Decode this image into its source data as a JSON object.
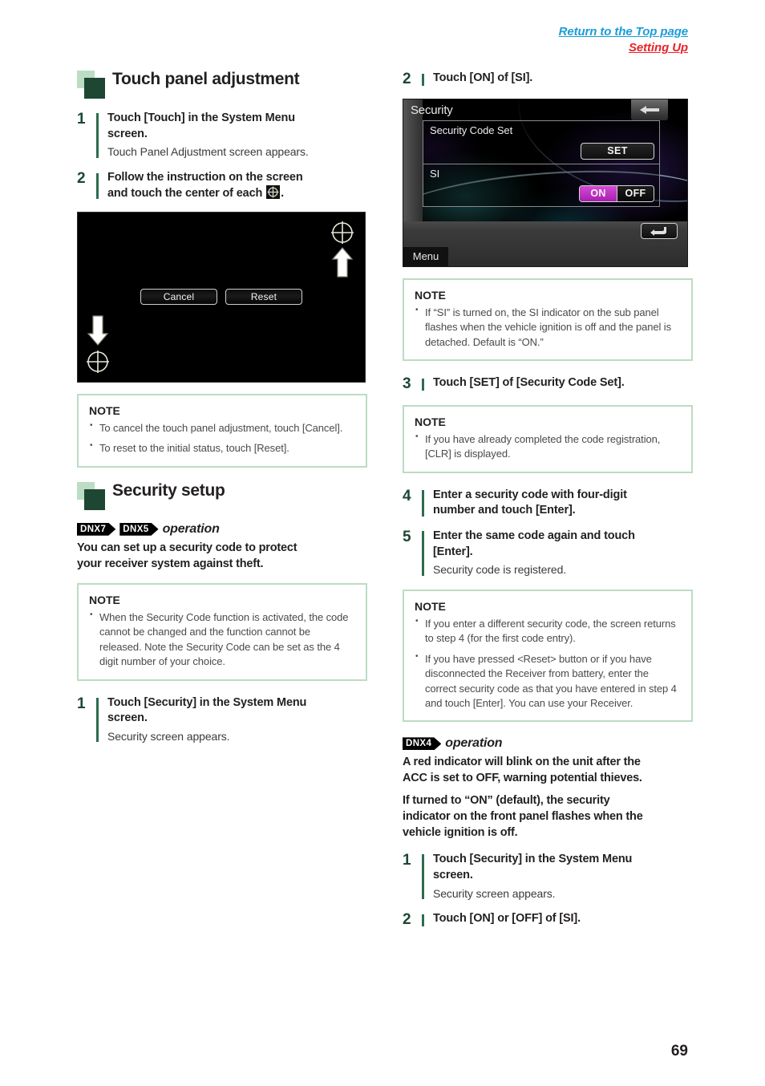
{
  "header": {
    "return_link": "Return to the Top page",
    "section_link": "Setting Up"
  },
  "page_number": "69",
  "left_column": {
    "section_title": "Touch panel adjustment",
    "steps": [
      {
        "num": "1",
        "title_a": "Touch [Touch] in the System Menu",
        "title_b": "screen.",
        "sub": "Touch Panel Adjustment screen appears."
      },
      {
        "num": "2",
        "title_a": "Follow the instruction on the screen",
        "title_b": "and touch the center of each",
        "title_c": "."
      }
    ],
    "touch_panel_screenshot": {
      "cancel_button": "Cancel",
      "reset_button": "Reset"
    },
    "note1": {
      "title": "NOTE",
      "items": [
        "To cancel the touch panel adjustment, touch [Cancel].",
        "To reset to the initial status, touch [Reset]."
      ]
    },
    "security_section_title": "Security setup",
    "operation": {
      "badges": [
        "DNX7",
        "DNX5"
      ],
      "word": "operation",
      "body_a": "You can set up a security code to protect",
      "body_b": "your receiver system against theft."
    },
    "note2": {
      "title": "NOTE",
      "items": [
        "When the Security Code function is activated, the code cannot be changed and the function cannot be released. Note the Security Code can be set as the 4 digit number of your choice."
      ]
    },
    "step_security_1": {
      "num": "1",
      "title_a": "Touch [Security] in the System Menu",
      "title_b": "screen.",
      "sub": "Security screen appears."
    }
  },
  "right_column": {
    "step2": {
      "num": "2",
      "title": "Touch [ON] of [SI]."
    },
    "security_screenshot": {
      "title": "Security",
      "row1_label": "Security Code Set",
      "set_button": "SET",
      "row2_label": "SI",
      "toggle_on": "ON",
      "toggle_off": "OFF",
      "menu_label": "Menu"
    },
    "note1": {
      "title": "NOTE",
      "items": [
        "If “SI” is turned on, the SI indicator on the sub panel flashes when the vehicle ignition is off and the panel is detached. Default is “ON.”"
      ]
    },
    "step3": {
      "num": "3",
      "title": "Touch [SET] of [Security Code Set]."
    },
    "note2": {
      "title": "NOTE",
      "items": [
        "If you have already completed the code registration, [CLR] is displayed."
      ]
    },
    "step4": {
      "num": "4",
      "title_a": "Enter a security code with four-digit",
      "title_b": "number and touch [Enter]."
    },
    "step5": {
      "num": "5",
      "title_a": "Enter the same code again and touch",
      "title_b": "[Enter].",
      "sub": "Security code is registered."
    },
    "note3": {
      "title": "NOTE",
      "items": [
        "If you enter a different security code, the screen returns to step 4 (for the first code entry).",
        "If you have pressed <Reset> button or if you have disconnected the Receiver from battery, enter the correct security code as that you have entered in step 4 and touch [Enter]. You can use your Receiver."
      ]
    },
    "operation": {
      "badge": "DNX4",
      "word": "operation",
      "body1_a": "A red indicator will blink on the unit after the",
      "body1_b": "ACC is set to OFF, warning potential thieves.",
      "body2_a": "If turned to “ON” (default), the security",
      "body2_b": "indicator on the front panel flashes when the",
      "body2_c": "vehicle ignition is off."
    },
    "step_last_1": {
      "num": "1",
      "title_a": "Touch [Security] in the System Menu",
      "title_b": "screen.",
      "sub": "Security screen appears."
    },
    "step_last_2": {
      "num": "2",
      "title": "Touch [ON] or [OFF] of [SI]."
    }
  }
}
